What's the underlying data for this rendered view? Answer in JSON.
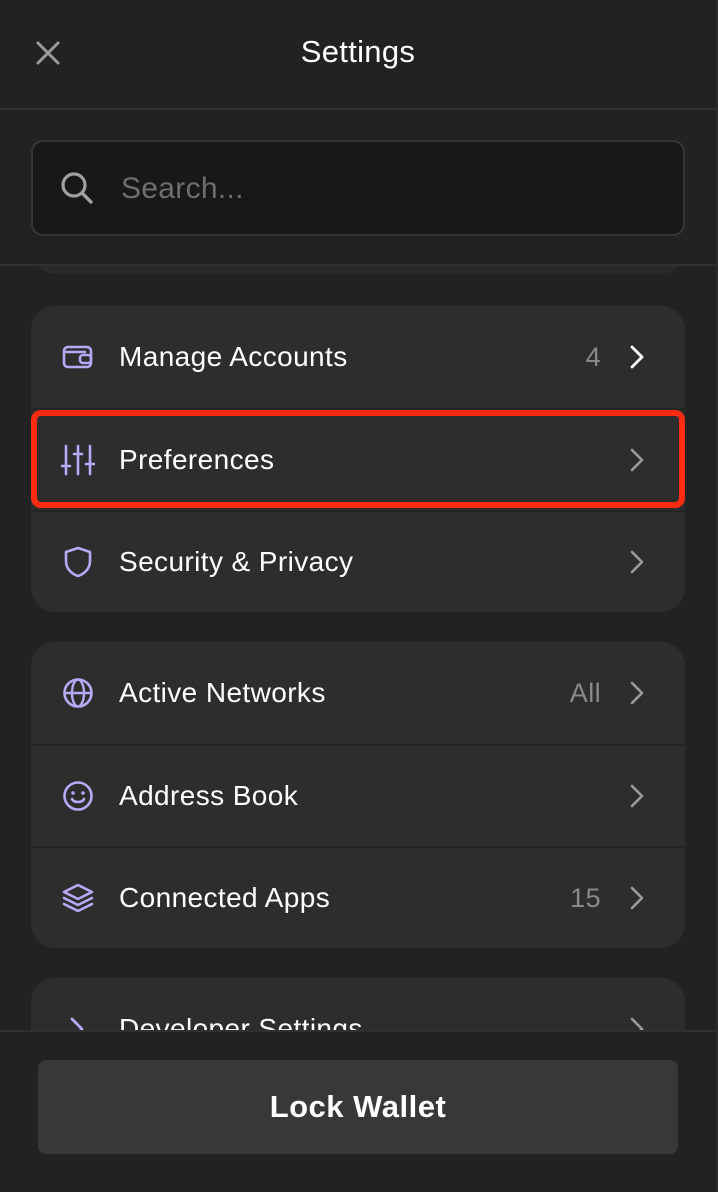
{
  "header": {
    "title": "Settings",
    "close_icon": "close-icon"
  },
  "search": {
    "placeholder": "Search...",
    "value": "",
    "icon": "search-icon"
  },
  "groups": [
    {
      "items": [
        {
          "icon": "wallet-icon",
          "label": "Manage Accounts",
          "value": "4"
        },
        {
          "icon": "sliders-icon",
          "label": "Preferences",
          "value": "",
          "highlighted": true
        },
        {
          "icon": "shield-icon",
          "label": "Security & Privacy",
          "value": ""
        }
      ]
    },
    {
      "items": [
        {
          "icon": "globe-icon",
          "label": "Active Networks",
          "value": "All"
        },
        {
          "icon": "smiley-icon",
          "label": "Address Book",
          "value": ""
        },
        {
          "icon": "layers-icon",
          "label": "Connected Apps",
          "value": "15"
        }
      ]
    },
    {
      "items": [
        {
          "icon": "chevron-right-icon",
          "label": "Developer Settings",
          "value": ""
        }
      ]
    }
  ],
  "footer": {
    "lock_label": "Lock Wallet"
  },
  "colors": {
    "background": "#222222",
    "card": "#2d2d2d",
    "icon_accent": "#b9a8f5",
    "highlight": "#ff2a12",
    "muted_text": "#8a8a8a"
  }
}
